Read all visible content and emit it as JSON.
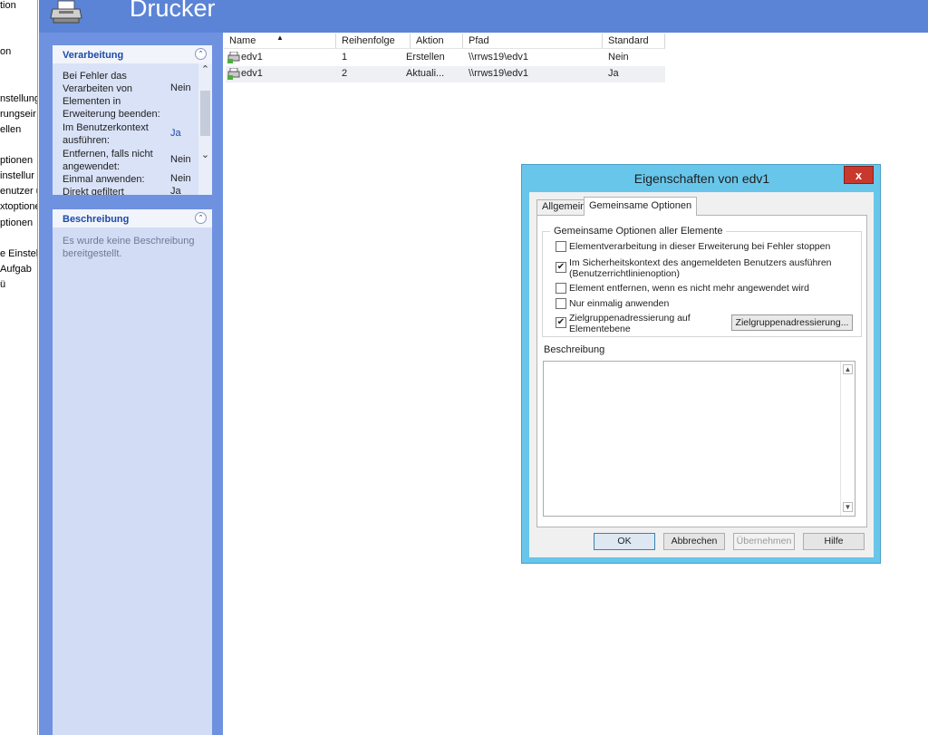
{
  "tree": {
    "items": [
      "tion",
      "on",
      "nstellung",
      "rungseir",
      "ellen",
      "ptionen",
      "instellur",
      "enutzer u",
      "xtoptione",
      "ptionen",
      "e Einstel",
      "Aufgab",
      "ü"
    ]
  },
  "header": {
    "title": "Drucker",
    "icon": "printer-icon"
  },
  "taskpane": {
    "processing": {
      "title": "Verarbeitung",
      "rows": [
        {
          "label": "Bei Fehler das Verarbeiten von Elementen in Erweiterung beenden:",
          "value": "Nein"
        },
        {
          "label": "Im Benutzerkontext ausführen:",
          "value": "Ja"
        },
        {
          "label": "Entfernen, falls nicht angewendet:",
          "value": "Nein"
        },
        {
          "label": "Einmal anwenden:",
          "value": "Nein"
        },
        {
          "label": "Direkt gefiltert",
          "value": "Ja"
        }
      ]
    },
    "description": {
      "title": "Beschreibung",
      "text": "Es wurde keine Beschreibung bereitgestellt."
    }
  },
  "list": {
    "columns": [
      "Name",
      "Reihenfolge",
      "Aktion",
      "Pfad",
      "Standard"
    ],
    "rows": [
      {
        "name": "edv1",
        "order": "1",
        "action": "Erstellen",
        "path": "\\\\rrws19\\edv1",
        "default": "Nein"
      },
      {
        "name": "edv1",
        "order": "2",
        "action": "Aktuali...",
        "path": "\\\\rrws19\\edv1",
        "default": "Ja"
      }
    ]
  },
  "dialog": {
    "title": "Eigenschaften von edv1",
    "close": "x",
    "tabs": [
      "Allgemein",
      "Gemeinsame Optionen"
    ],
    "group_title": "Gemeinsame Optionen aller Elemente",
    "options": [
      {
        "label": "Elementverarbeitung in dieser Erweiterung bei Fehler stoppen",
        "checked": false
      },
      {
        "label": "Im Sicherheitskontext des angemeldeten Benutzers ausführen",
        "label2": "(Benutzerrichtlinienoption)",
        "checked": true
      },
      {
        "label": "Element entfernen, wenn es nicht mehr angewendet wird",
        "checked": false
      },
      {
        "label": "Nur einmalig anwenden",
        "checked": false
      },
      {
        "label": "Zielgruppenadressierung auf",
        "label2": "Elementebene",
        "checked": true
      }
    ],
    "target_button": "Zielgruppenadressierung...",
    "description_label": "Beschreibung",
    "buttons": {
      "ok": "OK",
      "cancel": "Abbrechen",
      "apply": "Übernehmen",
      "help": "Hilfe"
    }
  }
}
